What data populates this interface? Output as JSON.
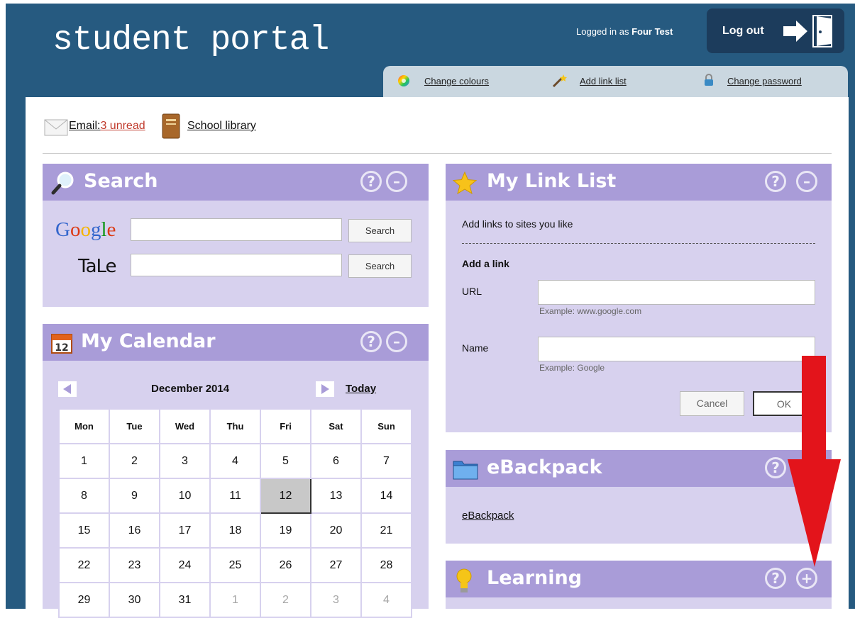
{
  "header": {
    "logo": "student portal",
    "logged_prefix": "Logged in as ",
    "user": "Four Test",
    "logout_label": "Log out"
  },
  "toolbar": {
    "change_colours": "Change colours",
    "add_link_list": "Add link list",
    "change_password": "Change password"
  },
  "quicklinks": {
    "email_label": "Email:",
    "email_unread": "3 unread",
    "library": "School library"
  },
  "search": {
    "title": "Search",
    "google_button": "Search",
    "tale_button": "Search",
    "google_logo": "Google",
    "tale_logo": "TaLe"
  },
  "calendar": {
    "title": "My Calendar",
    "month": "December 2014",
    "today_label": "Today",
    "headers": [
      "Mon",
      "Tue",
      "Wed",
      "Thu",
      "Fri",
      "Sat",
      "Sun"
    ],
    "weeks": [
      [
        "1",
        "2",
        "3",
        "4",
        "5",
        "6",
        "7"
      ],
      [
        "8",
        "9",
        "10",
        "11",
        "12",
        "13",
        "14"
      ],
      [
        "15",
        "16",
        "17",
        "18",
        "19",
        "20",
        "21"
      ],
      [
        "22",
        "23",
        "24",
        "25",
        "26",
        "27",
        "28"
      ],
      [
        "29",
        "30",
        "31",
        "1",
        "2",
        "3",
        "4"
      ]
    ],
    "selected_day": "12"
  },
  "linklist": {
    "title": "My Link List",
    "intro": "Add links to sites you like",
    "add_heading": "Add a link",
    "url_label": "URL",
    "url_example": "Example: www.google.com",
    "name_label": "Name",
    "name_example": "Example: Google",
    "cancel": "Cancel",
    "ok": "OK"
  },
  "ebackpack": {
    "title": "eBackpack",
    "link": "eBackpack"
  },
  "learning": {
    "title": "Learning"
  },
  "colors": {
    "header_bg": "#265a80",
    "panel_header": "#a99cd8",
    "panel_body": "#d7d1ee",
    "arrow": "#e3141b"
  }
}
